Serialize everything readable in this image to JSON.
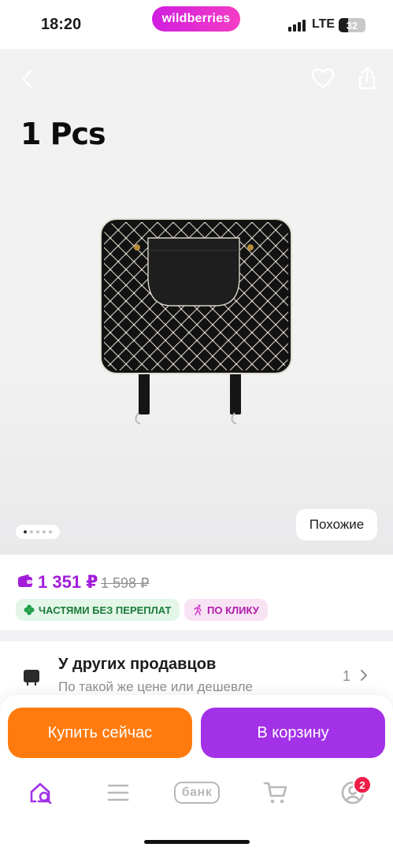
{
  "status_bar": {
    "time": "18:20",
    "brand": "wildberries",
    "network": "LTE",
    "battery": "32"
  },
  "gallery": {
    "photo_caption": "1 Pcs",
    "similar_label": "Похожие",
    "dots_count": 5,
    "active_dot": 1,
    "icons": [
      "back-icon",
      "heart-icon",
      "share-icon"
    ]
  },
  "price": {
    "current": "1 351 ₽",
    "old": "1 598 ₽",
    "badges": [
      {
        "label": "ЧАСТЯМИ БЕЗ ПЕРЕПЛАТ",
        "color": "#1b7a3a"
      },
      {
        "label": "ПО КЛИКУ",
        "color": "#b01aa8"
      }
    ]
  },
  "other_sellers": {
    "title": "У других продавцов",
    "subtitle": "По такой же цене или дешевле",
    "count": "1"
  },
  "actions": {
    "buy_now": "Купить сейчас",
    "add_to_cart": "В корзину"
  },
  "tab_bar": {
    "items": [
      {
        "name": "home",
        "icon": "home-search-icon"
      },
      {
        "name": "catalog",
        "icon": "menu-icon"
      },
      {
        "name": "bank",
        "label": "банк"
      },
      {
        "name": "cart",
        "icon": "cart-icon"
      },
      {
        "name": "profile",
        "icon": "profile-icon"
      }
    ],
    "profile_badge": "2"
  },
  "colors": {
    "brand": "#cb11ab",
    "price": "#a21cd8",
    "buy_now": "#ff7b0f",
    "add_to_cart": "#a231e8",
    "badge": "#ef1f4a"
  }
}
